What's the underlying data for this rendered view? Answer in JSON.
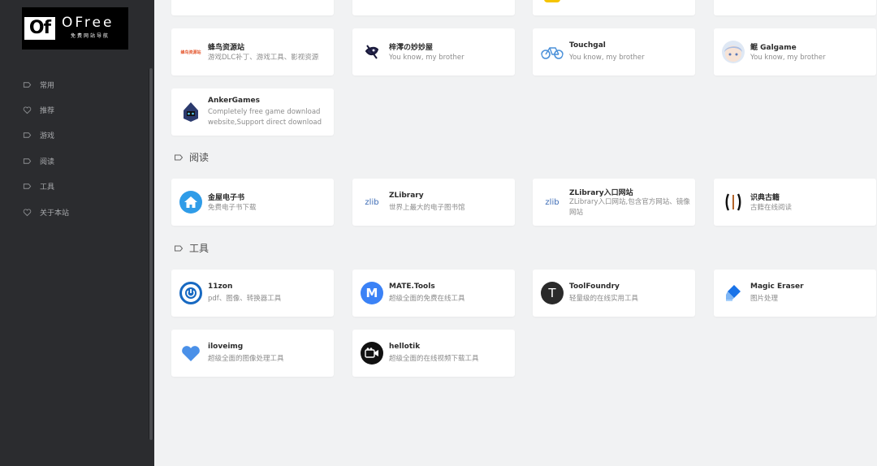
{
  "sidebar": {
    "logo": {
      "mark": "Of",
      "word": "OFree",
      "sub": "免费网站导航"
    },
    "items": [
      {
        "label": "常用",
        "icon": "tag-icon"
      },
      {
        "label": "推荐",
        "icon": "heart-icon"
      },
      {
        "label": "游戏",
        "icon": "tag-icon"
      },
      {
        "label": "阅读",
        "icon": "tag-icon"
      },
      {
        "label": "工具",
        "icon": "tag-icon"
      },
      {
        "label": "关于本站",
        "icon": "heart-icon"
      }
    ]
  },
  "games": {
    "cards": [
      {
        "title": "蜂鸟资源站",
        "desc": "游戏DLC补丁、游戏工具、影视资源",
        "logo_text": "蜂鸟资源站"
      },
      {
        "title": "梓澪の妙妙屋",
        "desc": "You know, my brother"
      },
      {
        "title": "Touchgal",
        "desc": "You know, my brother"
      },
      {
        "title": "鲲 Galgame",
        "desc": "You know, my brother"
      },
      {
        "title": "AnkerGames",
        "desc": "Completely free game download website,Support direct download"
      }
    ]
  },
  "reading": {
    "title": "阅读",
    "cards": [
      {
        "title": "金屋电子书",
        "desc": "免费电子书下载"
      },
      {
        "title": "ZLibrary",
        "desc": "世界上最大的电子图书馆",
        "logo_text": "zlib"
      },
      {
        "title": "ZLibrary入口网站",
        "desc": "ZLibrary入口网站,包含官方网站、镜像网站",
        "logo_text": "zlib"
      },
      {
        "title": "识典古籍",
        "desc": "古籍在线阅读"
      }
    ]
  },
  "tools": {
    "title": "工具",
    "cards": [
      {
        "title": "11zon",
        "desc": "pdf、图像、转换器工具"
      },
      {
        "title": "MATE.Tools",
        "desc": "超级全面的免费在线工具",
        "logo_text": "M"
      },
      {
        "title": "ToolFoundry",
        "desc": "轻量级的在线实用工具",
        "logo_text": "T"
      },
      {
        "title": "Magic Eraser",
        "desc": "图片处理"
      },
      {
        "title": "iloveimg",
        "desc": "超级全面的图像处理工具"
      },
      {
        "title": "hellotik",
        "desc": "超级全面的在线视频下载工具"
      }
    ]
  },
  "colors": {
    "sidebar_bg": "#2b2c2f",
    "page_bg": "#f1f2f3",
    "card_bg": "#ffffff",
    "accent_blue": "#1e88e5"
  }
}
